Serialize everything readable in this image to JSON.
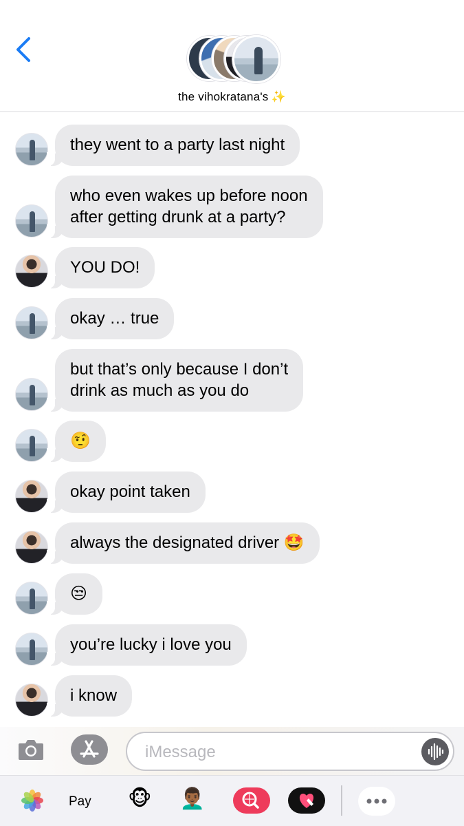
{
  "colors": {
    "accent_blue": "#1a7cf5",
    "incoming_bubble": "#e9e9eb",
    "battery_low": "#e02a2a",
    "search_app": "#ee3b5b"
  },
  "header": {
    "back_icon": "chevron-left-icon",
    "group_name": "the vihokratana's",
    "group_emoji": "✨"
  },
  "messages": [
    {
      "sender": "a",
      "text": "they went to a party last night"
    },
    {
      "sender": "a",
      "text": "who even wakes up before noon\nafter getting drunk at a party?"
    },
    {
      "sender": "b",
      "text": "YOU DO!"
    },
    {
      "sender": "a",
      "text": "okay … true"
    },
    {
      "sender": "a",
      "text": "but that’s only because I don’t\ndrink as much as you do"
    },
    {
      "sender": "a",
      "text": "🤨"
    },
    {
      "sender": "b",
      "text": "okay point taken"
    },
    {
      "sender": "b",
      "text": "always the designated driver 🤩"
    },
    {
      "sender": "a",
      "text": "😒"
    },
    {
      "sender": "a",
      "text": "you’re lucky i love you"
    },
    {
      "sender": "b",
      "text": "i know"
    }
  ],
  "input": {
    "placeholder": "iMessage",
    "camera_icon": "camera-icon",
    "apps_icon": "app-store-icon",
    "audio_icon": "audio-waveform-icon"
  },
  "drawer": {
    "photos_icon": "photos-icon",
    "applepay_apple": "",
    "applepay_label": "Pay",
    "memoji_1": "🐵",
    "memoji_2": "👨🏾‍🦱",
    "search_icon": "web-image-search-icon",
    "heart_icon": "digital-touch-icon",
    "more_label": "•••"
  }
}
